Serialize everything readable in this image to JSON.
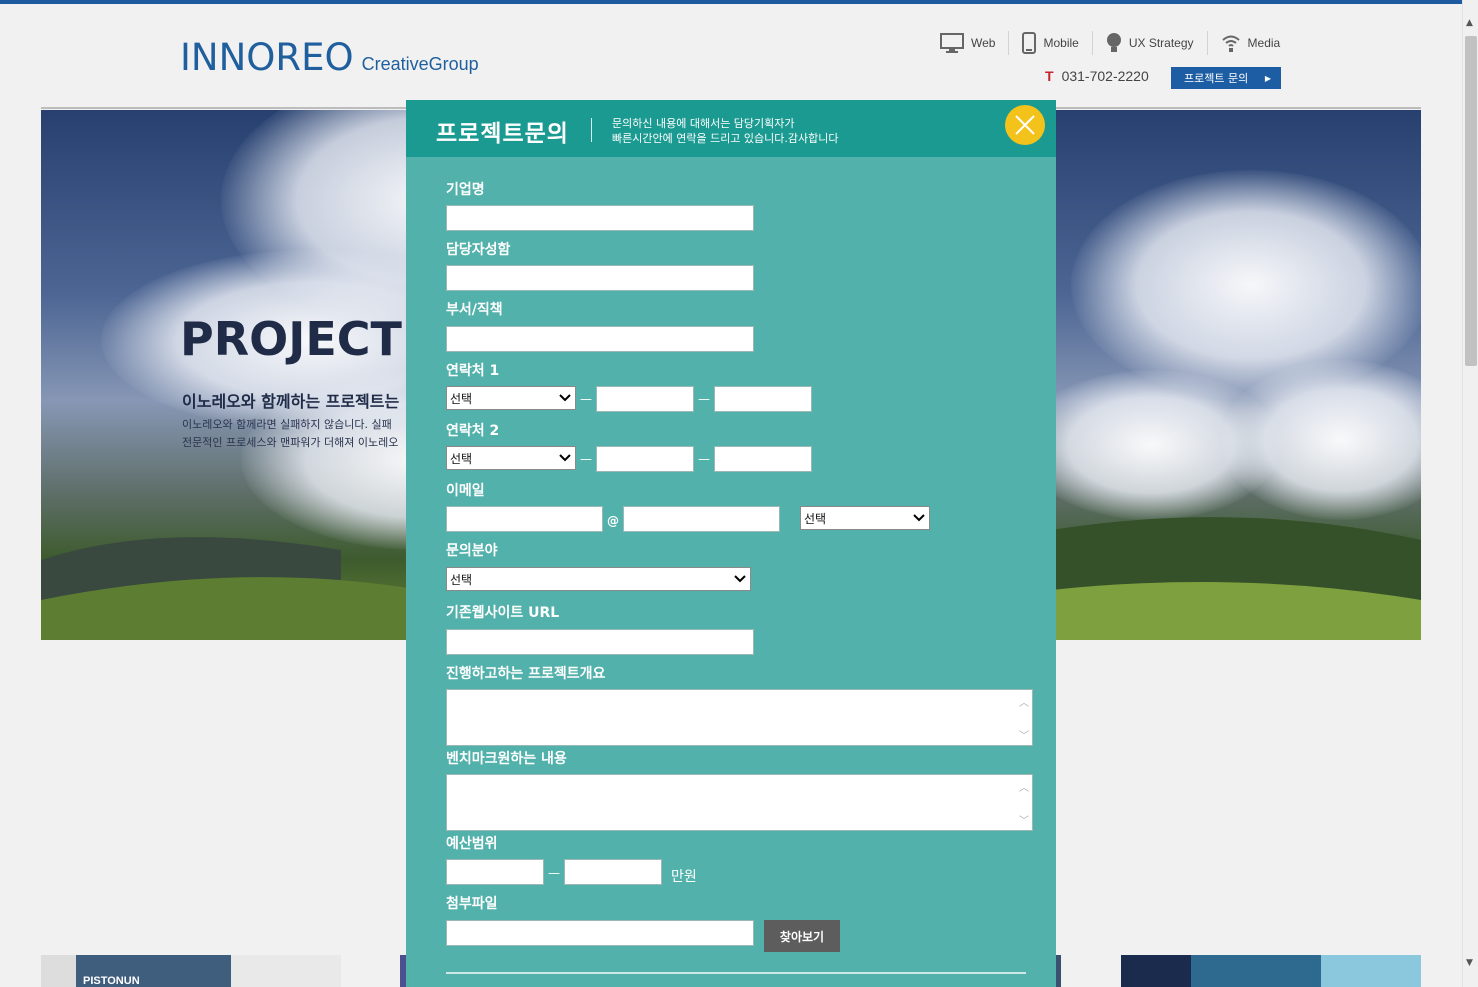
{
  "header": {
    "logo_main": "INNOREO",
    "logo_sub": "CreativeGroup",
    "nav": [
      {
        "label": "Web",
        "icon": "monitor-icon"
      },
      {
        "label": "Mobile",
        "icon": "mobile-icon"
      },
      {
        "label": "UX Strategy",
        "icon": "lightbulb-icon"
      },
      {
        "label": "Media",
        "icon": "wifi-icon"
      }
    ],
    "phone_prefix": "T",
    "phone": "031-702-2220",
    "inquiry_button": "프로젝트 문의"
  },
  "hero": {
    "title": "PROJECT S",
    "subtitle": "이노레오와 함께하는 프로젝트는",
    "desc_line1": "이노레오와 함께라면 실패하지 않습니다.  실패",
    "desc_line2": "전문적인 프로세스와 맨파워가 더해져  이노레오"
  },
  "thumbs": {
    "first_title": "PISTONUN"
  },
  "modal": {
    "title": "프로젝트문의",
    "desc_line1": "문의하신 내용에 대해서는 담당기획자가",
    "desc_line2": "빠른시간안에 연락을 드리고 있습니다.감사합니다",
    "fields": {
      "company": "기업명",
      "contact_name": "담당자성함",
      "department": "부서/직책",
      "phone1": "연락처 1",
      "phone2": "연락처 2",
      "email": "이메일",
      "inquiry_field": "문의분야",
      "website": "기존웹사이트 URL",
      "overview": "진행하고하는 프로젝트개요",
      "benchmark": "벤치마크원하는 내용",
      "budget": "예산범위",
      "attachment": "첨부파일"
    },
    "select_default": "선택",
    "dash": "—",
    "at": "@",
    "budget_unit": "만원",
    "browse_button": "찾아보기"
  },
  "colors": {
    "modal_bg": "#52b1ab",
    "modal_header": "#1a9a91",
    "close_btn": "#f3c21b",
    "brand_blue": "#1f5f9e"
  }
}
